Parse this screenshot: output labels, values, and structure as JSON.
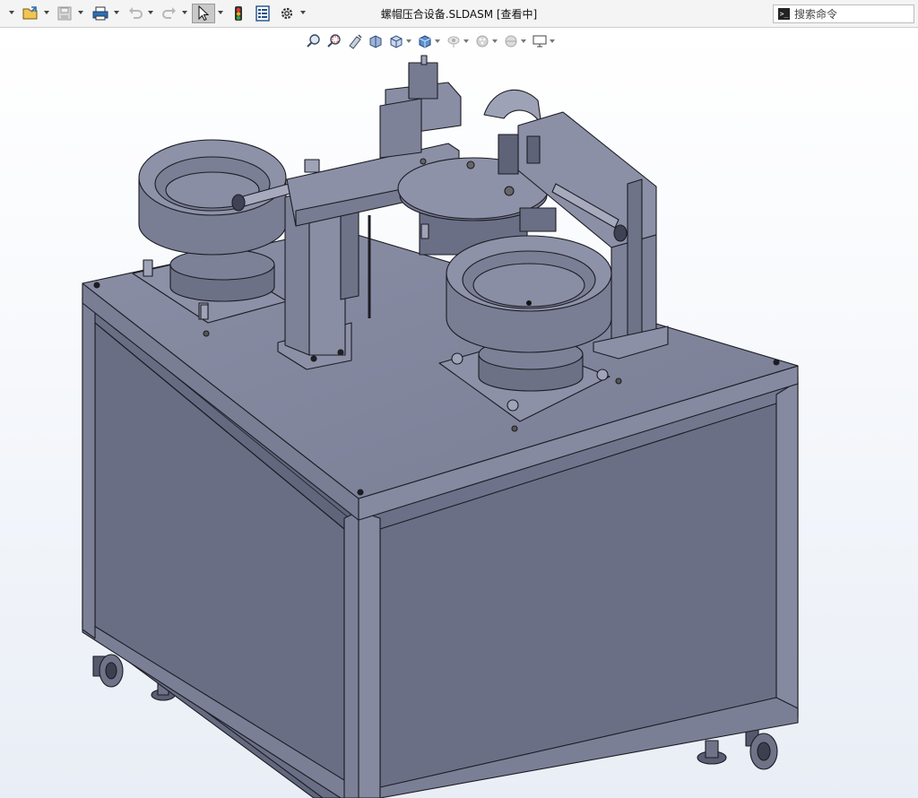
{
  "window": {
    "title": "螺帽压合设备.SLDASM [查看中]"
  },
  "search": {
    "placeholder": "搜索命令"
  },
  "toolbar": {
    "buttons": [
      "new",
      "open",
      "save",
      "print",
      "undo",
      "redo",
      "select",
      "rebuild",
      "file-properties",
      "options"
    ]
  },
  "heads_up_toolbar": {
    "buttons": [
      "zoom-to-fit",
      "zoom-to-area",
      "previous-view",
      "section-view",
      "view-orientation",
      "display-style",
      "hide-show-items",
      "edit-appearance",
      "apply-scene",
      "view-settings"
    ]
  },
  "colors": {
    "toolbar_bg": "#f4f4f4",
    "model_fill": "#6e7289",
    "model_light": "#8f93a8",
    "model_dark": "#555a70",
    "edge": "#1c1c24",
    "background_top": "#ffffff",
    "background_bottom": "#e9eef6"
  }
}
